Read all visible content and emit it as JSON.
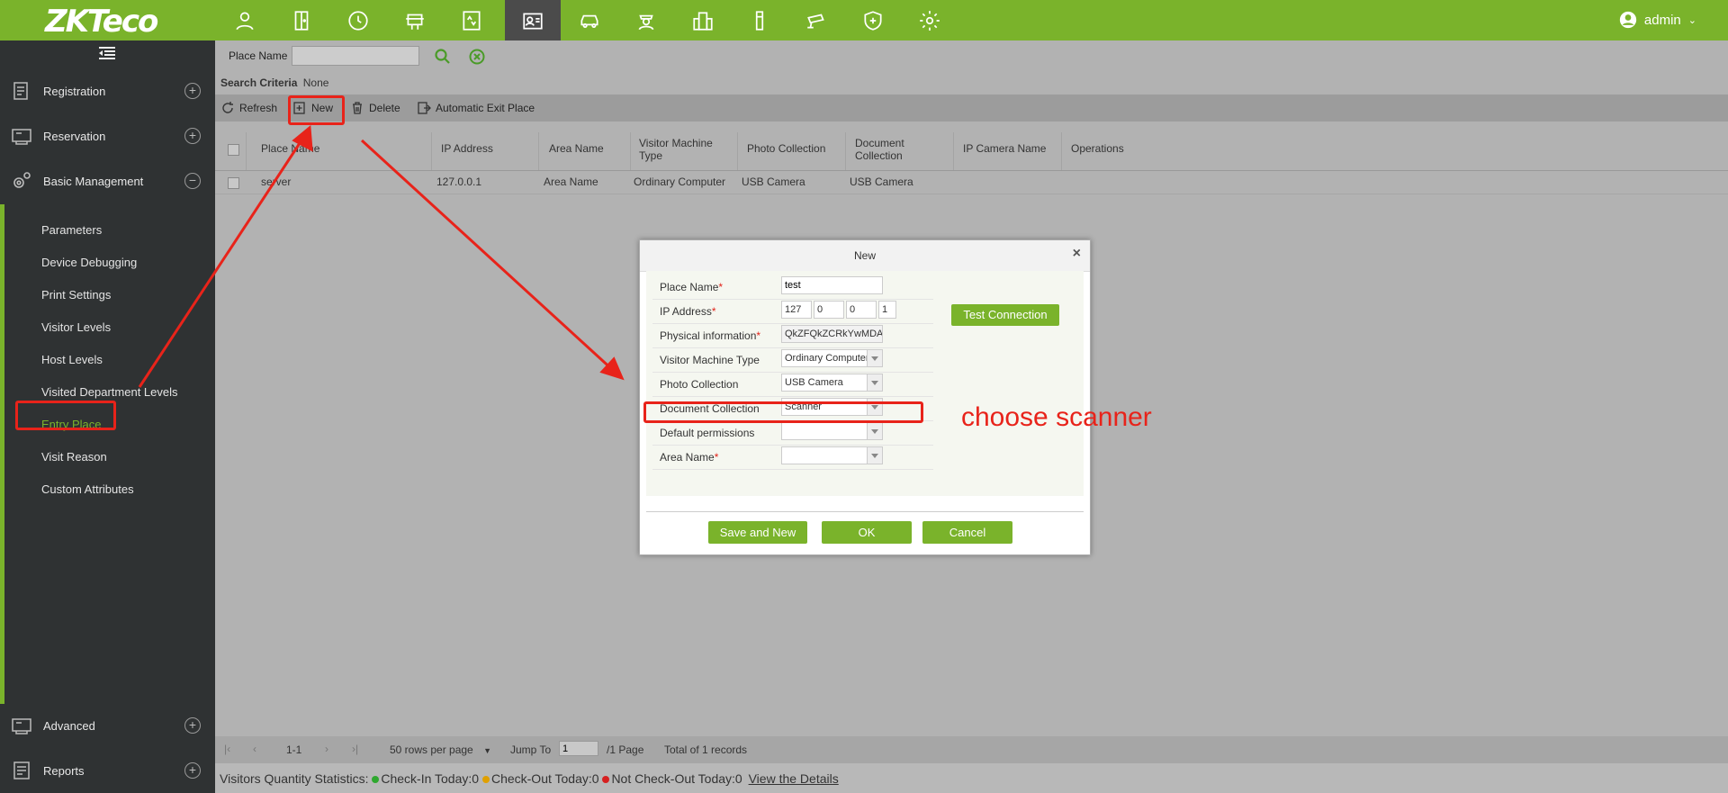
{
  "topbar": {
    "logo_text": "ZKTeco",
    "icons": [
      "visitor-icon",
      "door-icon",
      "clock-icon",
      "access-icon",
      "elevator-icon",
      "visitor-card-icon",
      "parking-icon",
      "guard-icon",
      "building-icon",
      "patrol-icon",
      "camera-icon",
      "shield-icon",
      "gear-icon"
    ],
    "user": "admin"
  },
  "sidebar": {
    "menus": [
      {
        "label": "Registration",
        "toggle": "+"
      },
      {
        "label": "Reservation",
        "toggle": "+"
      },
      {
        "label": "Basic Management",
        "toggle": "−"
      },
      {
        "label": "Advanced",
        "toggle": "+"
      },
      {
        "label": "Reports",
        "toggle": "+"
      }
    ],
    "submenu": [
      "Parameters",
      "Device Debugging",
      "Print Settings",
      "Visitor Levels",
      "Host Levels",
      "Visited Department Levels",
      "Entry Place",
      "Visit Reason",
      "Custom Attributes"
    ],
    "active_item": "Entry Place"
  },
  "search": {
    "label": "Place Name",
    "value": "",
    "criteria_label": "Search Criteria",
    "criteria_value": "None"
  },
  "toolbar": {
    "refresh": "Refresh",
    "new": "New",
    "delete": "Delete",
    "auto_exit": "Automatic Exit Place"
  },
  "table": {
    "columns": [
      "Place Name",
      "IP Address",
      "Area Name",
      "Visitor Machine Type",
      "Photo Collection",
      "Document Collection",
      "IP Camera Name",
      "Operations"
    ],
    "rows": [
      [
        "server",
        "127.0.0.1",
        "Area Name",
        "Ordinary Computer",
        "USB Camera",
        "USB Camera",
        "",
        ""
      ]
    ]
  },
  "pager": {
    "range": "1-1",
    "rows_per_page": "50 rows per page",
    "jump_label": "Jump To",
    "jump_value": "1",
    "page_total": "/1 Page",
    "records": "Total of 1 records"
  },
  "stats": {
    "label": "Visitors Quantity Statistics:",
    "checkin": "Check-In Today:0",
    "checkout": "Check-Out Today:0",
    "notcheckout": "Not Check-Out Today:0",
    "details": "View the Details",
    "colors": {
      "checkin": "#2fa82f",
      "checkout": "#e0a000",
      "notcheckout": "#d62020"
    }
  },
  "dialog": {
    "title": "New",
    "fields": {
      "place_name": {
        "label": "Place Name",
        "value": "test"
      },
      "ip": {
        "label": "IP Address",
        "octets": [
          "127",
          "0",
          "0",
          "1"
        ]
      },
      "physical": {
        "label": "Physical information",
        "value": "QkZFQkZCRkYwMDA4MD"
      },
      "machine_type": {
        "label": "Visitor Machine Type",
        "value": "Ordinary Computer"
      },
      "photo": {
        "label": "Photo Collection",
        "value": "USB Camera"
      },
      "document": {
        "label": "Document Collection",
        "value": "Scanner"
      },
      "permissions": {
        "label": "Default permissions",
        "value": ""
      },
      "area": {
        "label": "Area Name",
        "value": ""
      }
    },
    "test_connection": "Test Connection",
    "save_new": "Save and New",
    "ok": "OK",
    "cancel": "Cancel"
  },
  "annotation": "choose scanner",
  "colors": {
    "brand": "#7ab32b",
    "annotation": "#e8231a"
  }
}
